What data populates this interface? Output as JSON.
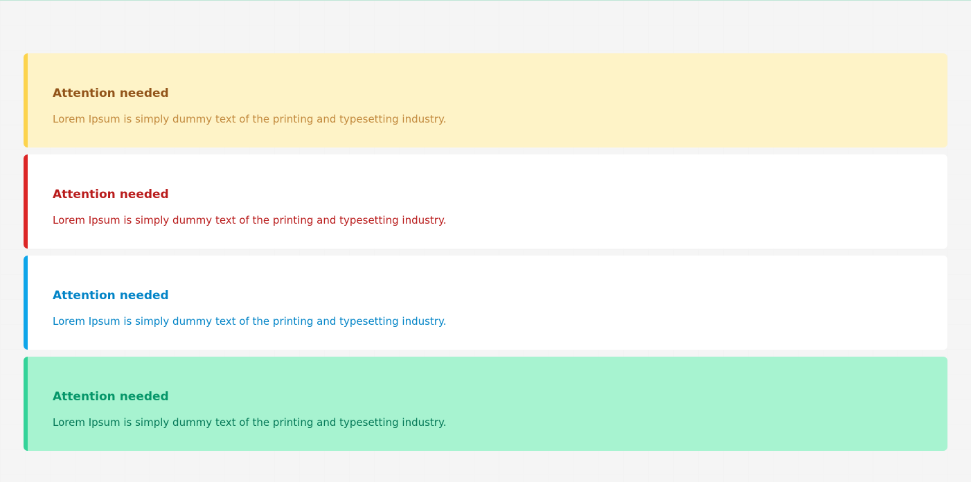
{
  "alerts": [
    {
      "variant": "warning",
      "title": "Attention needed",
      "text": "Lorem Ipsum is simply dummy text of the printing and typesetting industry.",
      "accent_color": "#fcd34d",
      "background_color": "#fef3c7"
    },
    {
      "variant": "error",
      "title": "Attention needed",
      "text": "Lorem Ipsum is simply dummy text of the printing and typesetting industry.",
      "accent_color": "#dc2626",
      "background_color": "#ffffff"
    },
    {
      "variant": "info",
      "title": "Attention needed",
      "text": "Lorem Ipsum is simply dummy text of the printing and typesetting industry.",
      "accent_color": "#0ea5e9",
      "background_color": "#ffffff"
    },
    {
      "variant": "success",
      "title": "Attention needed",
      "text": "Lorem Ipsum is simply dummy text of the printing and typesetting industry.",
      "accent_color": "#34d399",
      "background_color": "#a7f3d0"
    }
  ]
}
